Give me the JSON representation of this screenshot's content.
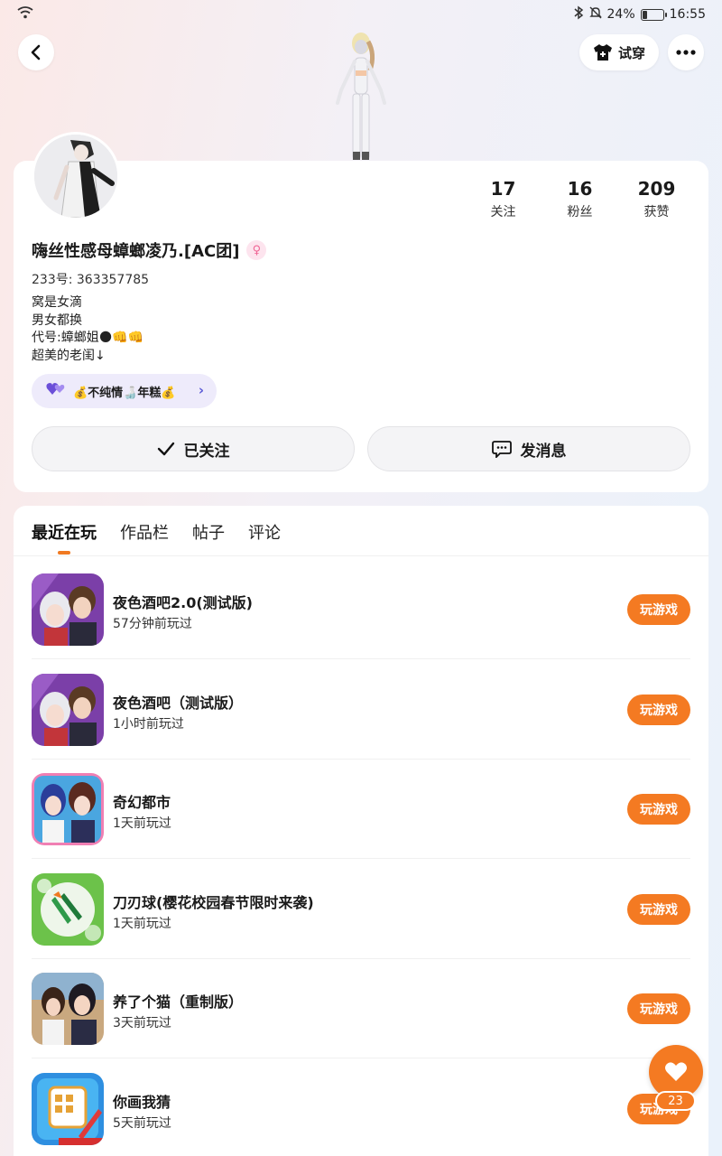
{
  "status_bar": {
    "battery": "24%",
    "battery_level": 0.24,
    "time": "16:55"
  },
  "header": {
    "tryon_label": "试穿"
  },
  "profile": {
    "stats": [
      {
        "value": "17",
        "label": "关注"
      },
      {
        "value": "16",
        "label": "粉丝"
      },
      {
        "value": "209",
        "label": "获赞"
      }
    ],
    "nickname": "嗨丝性感母蟑螂凌乃.[AC团]",
    "uid": "233号:  363357785",
    "bio_lines": [
      "窝是女滴",
      "男女都换",
      "代号:蟑螂姐🌑👊👊",
      "超美的老闺↓"
    ],
    "group_chip": "💰不纯情🍶年糕💰",
    "follow_label": "已关注",
    "message_label": "发消息"
  },
  "tabs": [
    "最近在玩",
    "作品栏",
    "帖子",
    "评论"
  ],
  "games": [
    {
      "title": "夜色酒吧2.0(测试版)",
      "time": "57分钟前玩过",
      "button": "玩游戏"
    },
    {
      "title": "夜色酒吧（测试版）",
      "time": "1小时前玩过",
      "button": "玩游戏"
    },
    {
      "title": "奇幻都市",
      "time": "1天前玩过",
      "button": "玩游戏"
    },
    {
      "title": "刀刃球(樱花校园春节限时来袭)",
      "time": "1天前玩过",
      "button": "玩游戏"
    },
    {
      "title": "养了个猫（重制版）",
      "time": "3天前玩过",
      "button": "玩游戏"
    },
    {
      "title": "你画我猜",
      "time": "5天前玩过",
      "button": "玩游戏"
    }
  ],
  "fab": {
    "count": "23"
  },
  "colors": {
    "accent": "#f47a22",
    "chip_bg": "#eeebfb"
  }
}
